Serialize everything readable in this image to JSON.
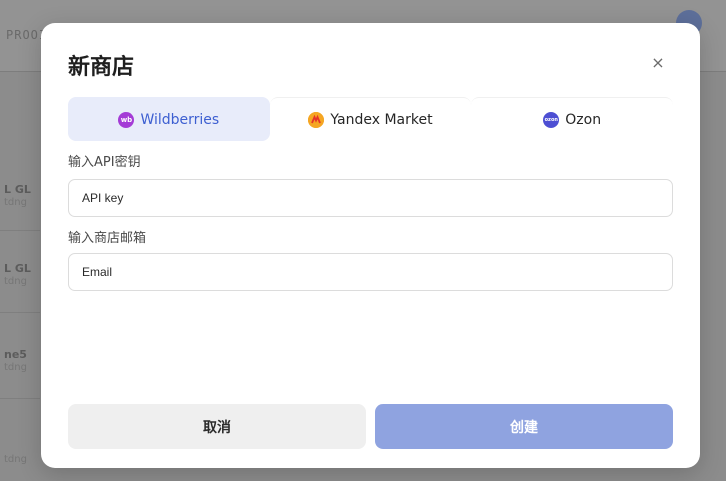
{
  "background": {
    "topbar_text": "PROOI",
    "rows": [
      {
        "name": "L GL",
        "sub": "tdng"
      },
      {
        "name": "L GL",
        "sub": "tdng"
      },
      {
        "name": "ne5",
        "sub": "tdng"
      },
      {
        "name": "",
        "sub": "tdng"
      }
    ]
  },
  "modal": {
    "title": "新商店",
    "close_label": "×",
    "tabs": [
      {
        "label": "Wildberries",
        "icon": "wildberries-icon",
        "icon_text": "wb",
        "color": "#a43bd6",
        "active": true
      },
      {
        "label": "Yandex Market",
        "icon": "yandex-market-icon",
        "icon_text": "",
        "color": "#f5a623",
        "active": false
      },
      {
        "label": "Ozon",
        "icon": "ozon-icon",
        "icon_text": "ozon",
        "color": "#4d4fd3",
        "active": false
      }
    ],
    "api_key": {
      "label": "输入API密钥",
      "placeholder": "API key",
      "value": ""
    },
    "email": {
      "label": "输入商店邮箱",
      "placeholder": "Email",
      "value": ""
    },
    "cancel_label": "取消",
    "create_label": "创建"
  },
  "colors": {
    "accent": "#3d5fd1",
    "active_tab_bg": "#e8ecfa",
    "create_button": "#8fa3e0",
    "cancel_button": "#efefef"
  }
}
